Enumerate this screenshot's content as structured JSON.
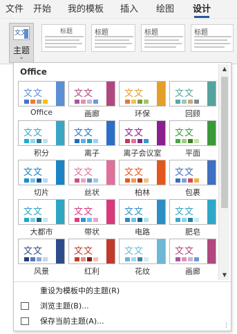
{
  "ribbon": {
    "tabs": [
      {
        "label": "文件",
        "active": false
      },
      {
        "label": "开始",
        "active": false
      },
      {
        "label": "我的模板",
        "active": false
      },
      {
        "label": "插入",
        "active": false
      },
      {
        "label": "绘图",
        "active": false
      },
      {
        "label": "设计",
        "active": true
      }
    ],
    "theme_button_label": "主题",
    "theme_button_icon": "文文",
    "chevron": "⌄",
    "doc_thumbs": [
      "标题",
      "标题",
      "标题",
      "标题"
    ]
  },
  "panel": {
    "header": "Office",
    "themes": [
      {
        "name": "Office",
        "icon": "文文",
        "accent": "#5b8fd6",
        "swatches": [
          "#4472c4",
          "#ed7d31",
          "#a5a5a5",
          "#ffc000"
        ]
      },
      {
        "name": "画廊",
        "icon": "文文",
        "accent": "#b1477f",
        "swatches": [
          "#a5579e",
          "#e68eb7",
          "#c3b7d6",
          "#6e9ad4"
        ]
      },
      {
        "name": "环保",
        "icon": "文文",
        "accent": "#e2a02b",
        "swatches": [
          "#e07b39",
          "#f4c24f",
          "#7b9b3e",
          "#a3c36b"
        ]
      },
      {
        "name": "回顾",
        "icon": "文文",
        "accent": "#54a49d",
        "swatches": [
          "#5aa6a0",
          "#98c9c2",
          "#c9a97f",
          "#7e8c9a"
        ]
      },
      {
        "name": "积分",
        "icon": "文文",
        "accent": "#3aa6c4",
        "swatches": [
          "#1cadd6",
          "#8ed8ea",
          "#2f7b96",
          "#b8e4ef"
        ]
      },
      {
        "name": "离子",
        "icon": "文文",
        "accent": "#2b6fc6",
        "swatches": [
          "#1f6cc6",
          "#5fb0e8",
          "#25a4b5",
          "#9bd3f2"
        ]
      },
      {
        "name": "离子会议室",
        "icon": "文文",
        "accent": "#8b1f8d",
        "swatches": [
          "#c23a5a",
          "#e76f9b",
          "#7b2a8c",
          "#3c98c8"
        ]
      },
      {
        "name": "平面",
        "icon": "文文",
        "accent": "#3a9a3a",
        "swatches": [
          "#49a648",
          "#9ad07a",
          "#3b7d2f",
          "#c8e3a3"
        ]
      },
      {
        "name": "切片",
        "icon": "文文",
        "accent": "#1b84c4",
        "swatches": [
          "#1b8ecf",
          "#77c2ea",
          "#0e5b96",
          "#aedcf3"
        ]
      },
      {
        "name": "丝状",
        "icon": "文文",
        "accent": "#e06f9a",
        "swatches": [
          "#d34c86",
          "#f1a1c1",
          "#6a8fbf",
          "#a9c7e7"
        ]
      },
      {
        "name": "柏林",
        "icon": "文文",
        "accent": "#e2571b",
        "swatches": [
          "#e45a1c",
          "#f29a4c",
          "#b53515",
          "#f3c283"
        ]
      },
      {
        "name": "包裹",
        "icon": "文文",
        "accent": "#3f6fc0",
        "swatches": [
          "#3d6cb9",
          "#7ba1dc",
          "#d24b4b",
          "#f0b341"
        ]
      },
      {
        "name": "大都市",
        "icon": "文文",
        "accent": "#2da6c4",
        "swatches": [
          "#1ea7c9",
          "#7fd0e3",
          "#176a85",
          "#c1e9f2"
        ]
      },
      {
        "name": "带状",
        "icon": "文文",
        "accent": "#d8397a",
        "swatches": [
          "#e03c86",
          "#3b8fd6",
          "#66c6e8",
          "#f5a0c4"
        ]
      },
      {
        "name": "电路",
        "icon": "文文",
        "accent": "#2d8ec4",
        "swatches": [
          "#2b8bc4",
          "#6ec6e8",
          "#1b5d8a",
          "#aee0f3"
        ]
      },
      {
        "name": "肥皂",
        "icon": "文文",
        "accent": "#2fa8c8",
        "swatches": [
          "#35aacb",
          "#8bd4e6",
          "#2a7f9b",
          "#c7ebf4"
        ]
      },
      {
        "name": "风景",
        "icon": "文文",
        "accent": "#2d4c8a",
        "swatches": [
          "#203f7d",
          "#5479b7",
          "#8ea9d7",
          "#c6d5ec"
        ]
      },
      {
        "name": "红利",
        "icon": "文文",
        "accent": "#c0392b",
        "swatches": [
          "#c43a2e",
          "#e98c78",
          "#7c1e1a",
          "#f3c1b2"
        ]
      },
      {
        "name": "花纹",
        "icon": "文文",
        "accent": "#6fb7d6",
        "swatches": [
          "#69b5d8",
          "#a5d6ea",
          "#3c85a8",
          "#d5ecf5"
        ]
      },
      {
        "name": "画廊",
        "icon": "文文",
        "accent": "#b1477f",
        "swatches": [
          "#a5579e",
          "#e68eb7",
          "#c3b7d6",
          "#6e9ad4"
        ]
      }
    ],
    "menu": {
      "reset": "重设为模板中的主题(R)",
      "browse": "浏览主题(B)...",
      "save": "保存当前主题(A)..."
    },
    "scroll_up": "▲",
    "scroll_down": "▼",
    "grip": "⋮"
  }
}
